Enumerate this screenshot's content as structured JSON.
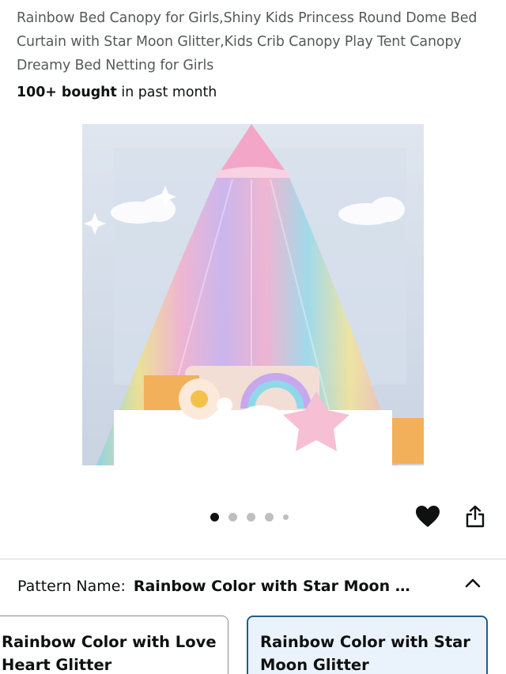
{
  "product": {
    "title": "Rainbow Bed Canopy for Girls,Shiny Kids Princess Round Dome Bed Curtain with Star Moon Glitter,Kids Crib Canopy Play Tent Canopy Dreamy Bed Netting for Girls",
    "bought_count": "100+ bought",
    "bought_suffix": " in past month"
  },
  "gallery": {
    "image_count": 5,
    "active_index": 0
  },
  "icons": {
    "favorite": "heart-icon",
    "share": "share-icon",
    "collapse": "chevron-up-icon"
  },
  "variation": {
    "label": "Pattern Name:",
    "selected": "Rainbow Color with Star Moon …",
    "options": [
      {
        "label": "Rainbow Color with Love Heart Glitter",
        "selected": false
      },
      {
        "label": "Rainbow Color with Star Moon Glitter",
        "selected": true
      }
    ]
  },
  "colors": {
    "text": "#0f1111",
    "muted": "#565959",
    "selected_border": "#1e5f8a",
    "selected_bg": "#eaf3fb"
  }
}
